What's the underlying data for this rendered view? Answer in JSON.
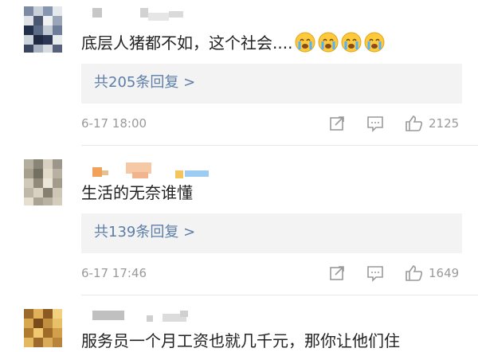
{
  "comments": [
    {
      "text": "底层人猪都不如，这个社会....",
      "reply_label": "共205条回复 >",
      "time": "6-17 18:00",
      "likes": "2125",
      "emoji": [
        "crying-face",
        "crying-face",
        "crying-face",
        "crying-face"
      ]
    },
    {
      "text": "生活的无奈谁懂",
      "reply_label": "共139条回复 >",
      "time": "6-17 17:46",
      "likes": "1649"
    },
    {
      "text": "服务员一个月工资也就几千元，那你让他们住"
    }
  ],
  "icons": [
    "share-icon",
    "comment-icon",
    "like-icon"
  ],
  "colors": {
    "link": "#5d7ea8",
    "muted": "#9a9a9a",
    "reply_bg": "#f3f3f3"
  }
}
